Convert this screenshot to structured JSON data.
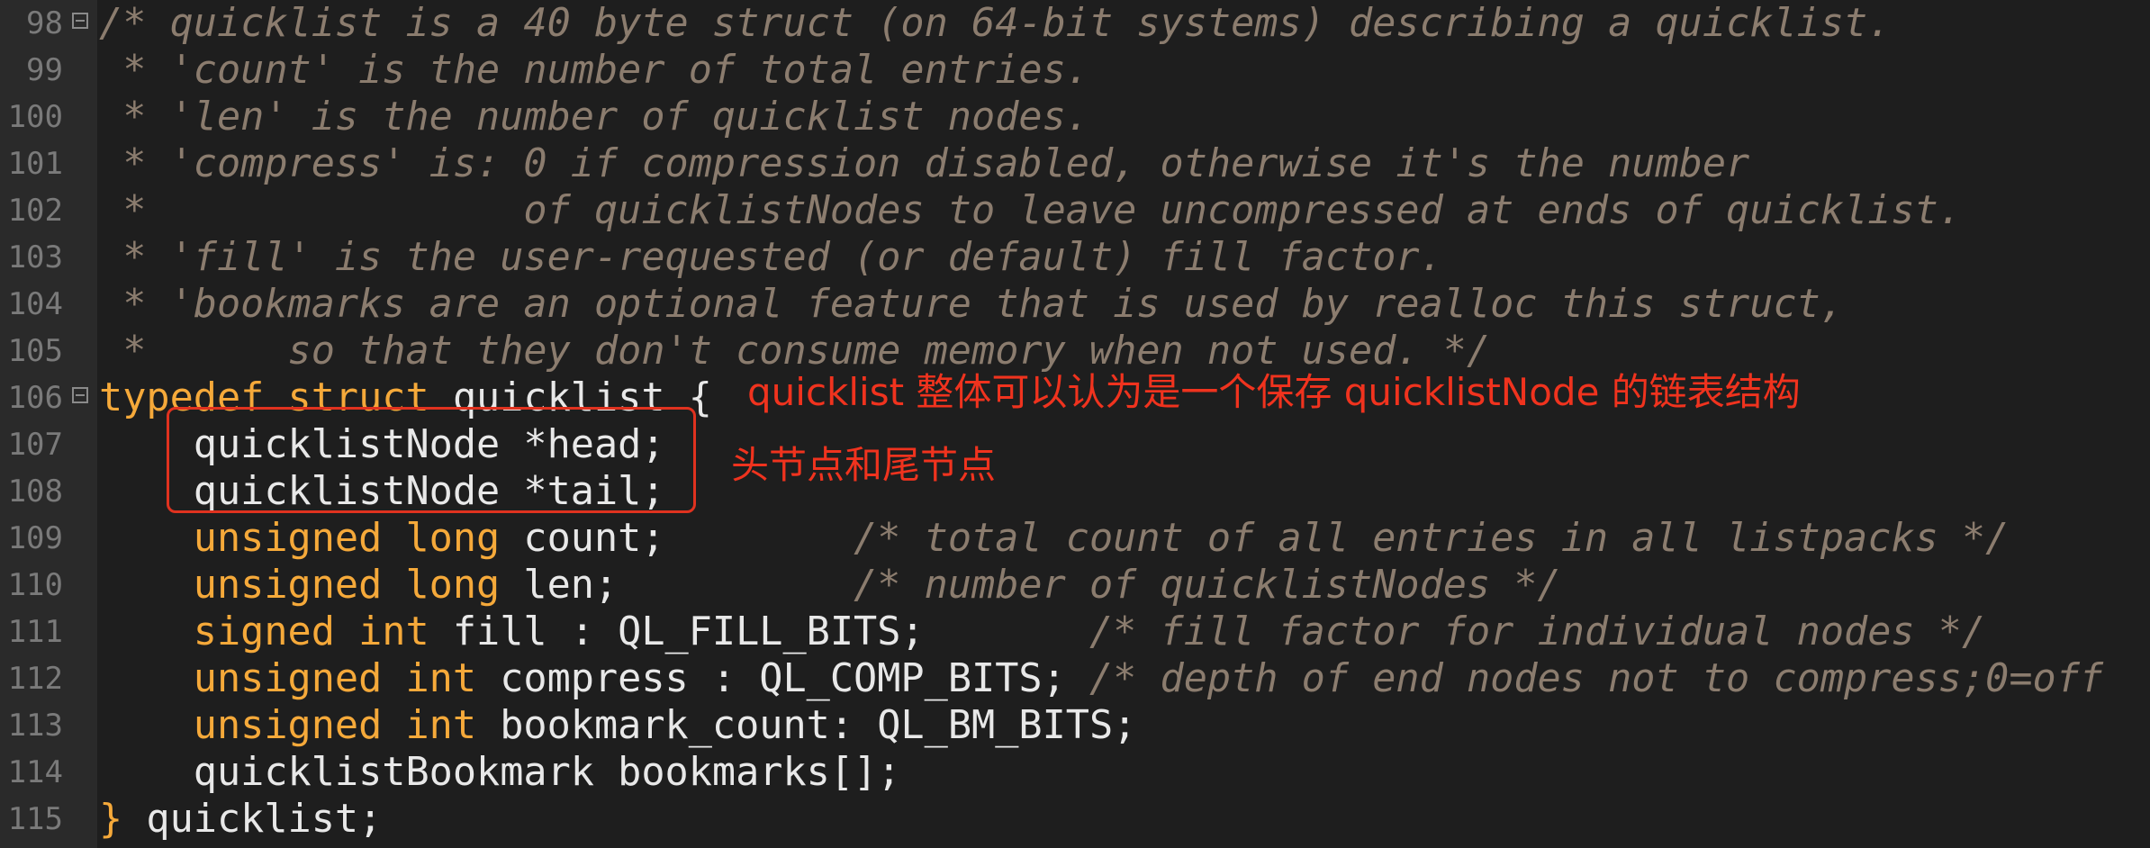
{
  "colors": {
    "background": "#1e1e1e",
    "gutter": "#2a2a2a",
    "line_number": "#7a7a7a",
    "comment": "#8b7c6e",
    "keyword": "#f5a93a",
    "text": "#e8e8e8",
    "annotation": "#f0331e"
  },
  "lines": [
    {
      "num": "98",
      "fold": true,
      "tokens": [
        {
          "cls": "c",
          "text": "/* quicklist is a 40 byte struct (on 64-bit systems) describing a quicklist."
        }
      ]
    },
    {
      "num": "99",
      "fold": false,
      "tokens": [
        {
          "cls": "c",
          "text": " * 'count' is the number of total entries."
        }
      ]
    },
    {
      "num": "100",
      "fold": false,
      "tokens": [
        {
          "cls": "c",
          "text": " * 'len' is the number of quicklist nodes."
        }
      ]
    },
    {
      "num": "101",
      "fold": false,
      "tokens": [
        {
          "cls": "c",
          "text": " * 'compress' is: 0 if compression disabled, otherwise it's the number"
        }
      ]
    },
    {
      "num": "102",
      "fold": false,
      "tokens": [
        {
          "cls": "c",
          "text": " *                of quicklistNodes to leave uncompressed at ends of quicklist."
        }
      ]
    },
    {
      "num": "103",
      "fold": false,
      "tokens": [
        {
          "cls": "c",
          "text": " * 'fill' is the user-requested (or default) fill factor."
        }
      ]
    },
    {
      "num": "104",
      "fold": false,
      "tokens": [
        {
          "cls": "c",
          "text": " * 'bookmarks are an optional feature that is used by realloc this struct,"
        }
      ]
    },
    {
      "num": "105",
      "fold": false,
      "tokens": [
        {
          "cls": "c",
          "text": " *      so that they don't consume memory when not used. */"
        }
      ]
    },
    {
      "num": "106",
      "fold": true,
      "tokens": [
        {
          "cls": "k",
          "text": "typedef struct"
        },
        {
          "cls": "t",
          "text": " quicklist {"
        }
      ]
    },
    {
      "num": "107",
      "fold": false,
      "tokens": [
        {
          "cls": "t",
          "text": "    quicklistNode *head;"
        }
      ]
    },
    {
      "num": "108",
      "fold": false,
      "tokens": [
        {
          "cls": "t",
          "text": "    quicklistNode *tail;"
        }
      ]
    },
    {
      "num": "109",
      "fold": false,
      "tokens": [
        {
          "cls": "k",
          "text": "    unsigned long"
        },
        {
          "cls": "t",
          "text": " count;        "
        },
        {
          "cls": "c",
          "text": "/* total count of all entries in all listpacks */"
        }
      ]
    },
    {
      "num": "110",
      "fold": false,
      "tokens": [
        {
          "cls": "k",
          "text": "    unsigned long"
        },
        {
          "cls": "t",
          "text": " len;          "
        },
        {
          "cls": "c",
          "text": "/* number of quicklistNodes */"
        }
      ]
    },
    {
      "num": "111",
      "fold": false,
      "tokens": [
        {
          "cls": "k",
          "text": "    signed int"
        },
        {
          "cls": "t",
          "text": " fill : QL_FILL_BITS;       "
        },
        {
          "cls": "c",
          "text": "/* fill factor for individual nodes */"
        }
      ]
    },
    {
      "num": "112",
      "fold": false,
      "tokens": [
        {
          "cls": "k",
          "text": "    unsigned int"
        },
        {
          "cls": "t",
          "text": " compress : QL_COMP_BITS; "
        },
        {
          "cls": "c",
          "text": "/* depth of end nodes not to compress;0=off"
        }
      ]
    },
    {
      "num": "113",
      "fold": false,
      "tokens": [
        {
          "cls": "k",
          "text": "    unsigned int"
        },
        {
          "cls": "t",
          "text": " bookmark_count: QL_BM_BITS;"
        }
      ]
    },
    {
      "num": "114",
      "fold": false,
      "tokens": [
        {
          "cls": "t",
          "text": "    quicklistBookmark bookmarks[];"
        }
      ]
    },
    {
      "num": "115",
      "fold": false,
      "tokens": [
        {
          "cls": "k",
          "text": "}"
        },
        {
          "cls": "t",
          "text": " quicklist;"
        }
      ]
    }
  ],
  "annotations": {
    "struct_note": "quicklist 整体可以认为是一个保存 quicklistNode 的链表结构",
    "head_tail_note": "头节点和尾节点"
  }
}
